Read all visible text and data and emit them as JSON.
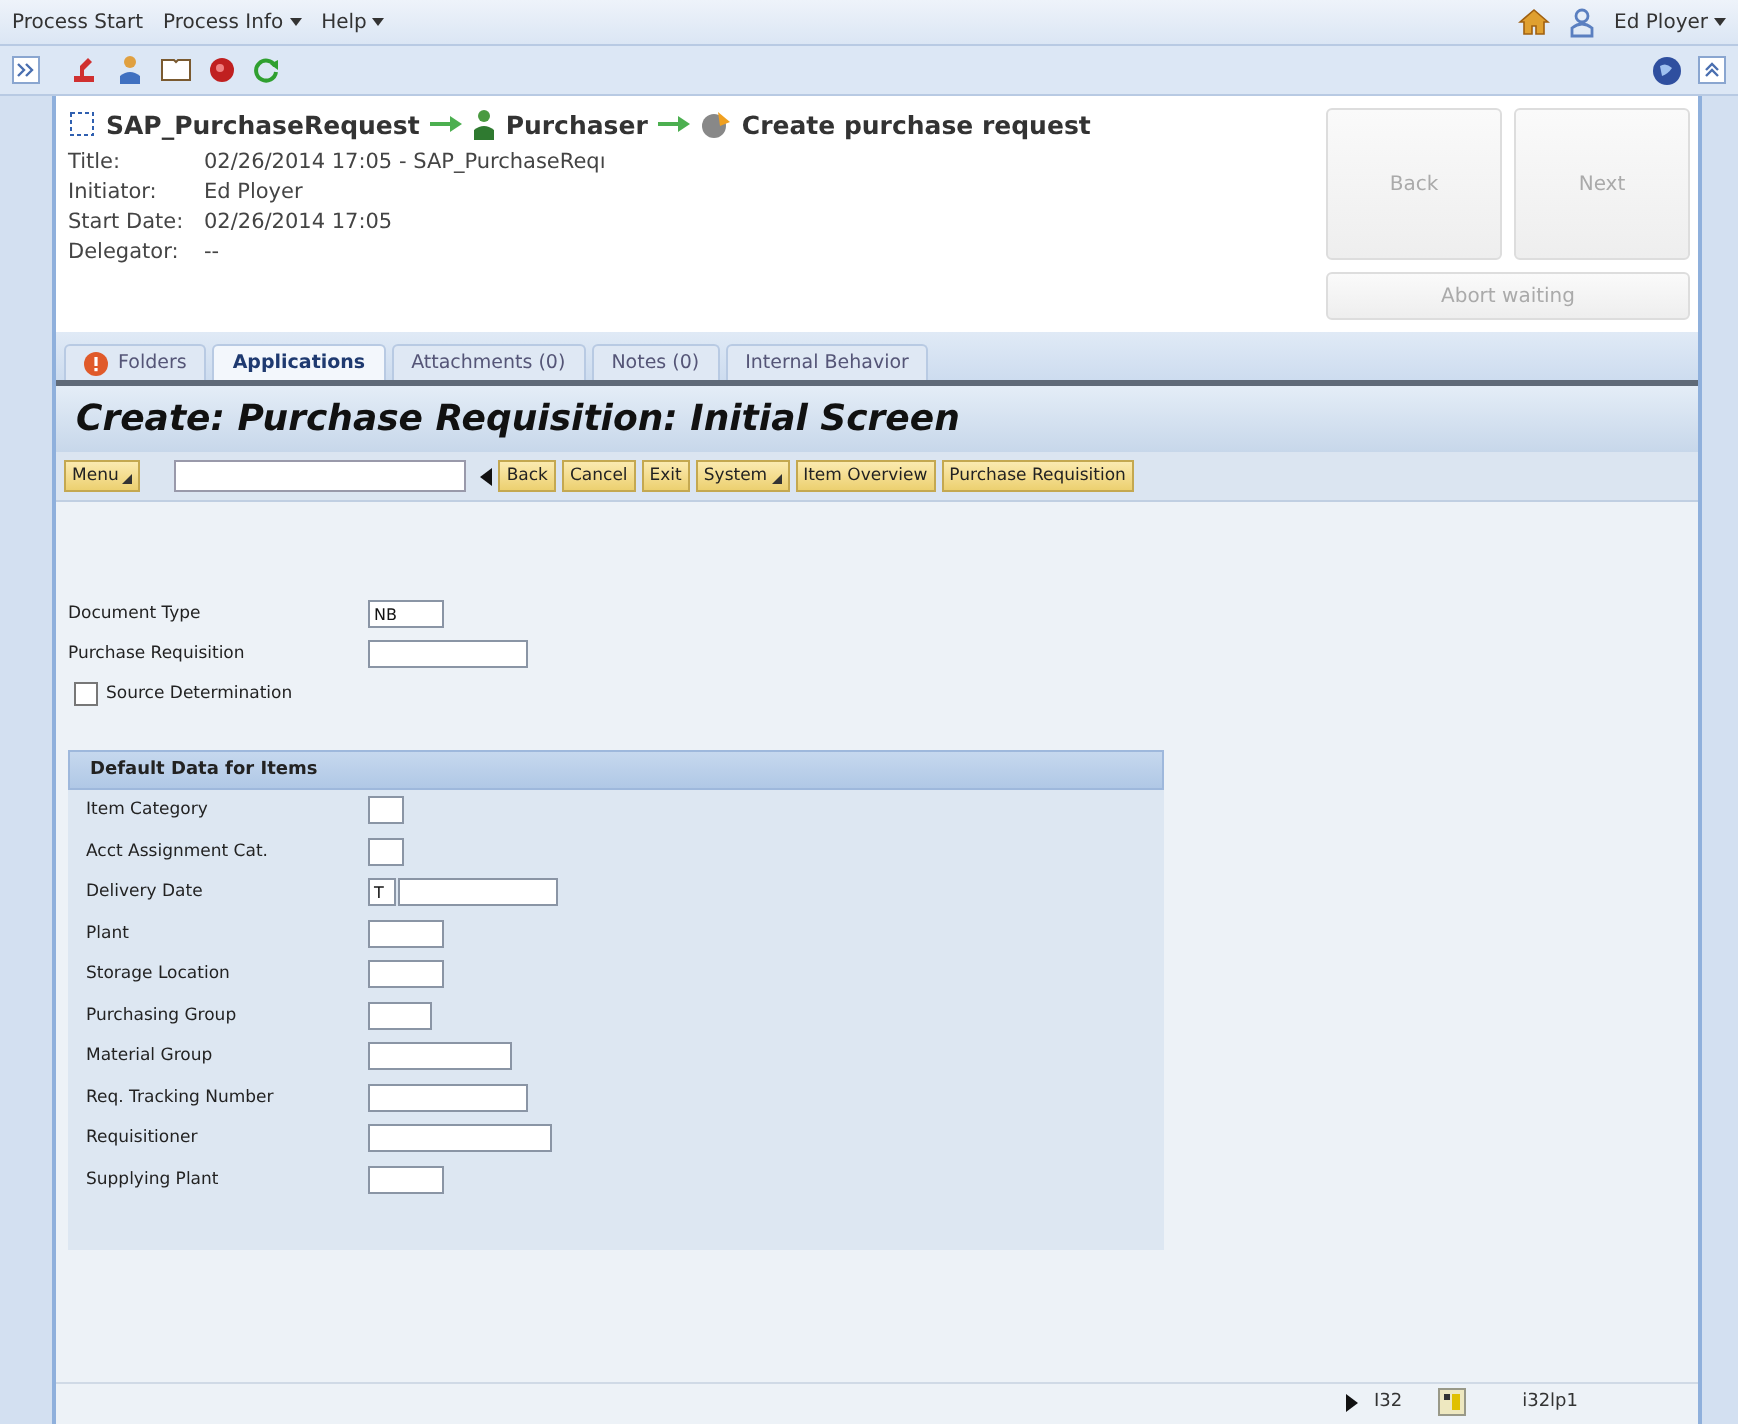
{
  "menu_bar": {
    "items": [
      {
        "label": "Process Start",
        "dropdown": false
      },
      {
        "label": "Process Info",
        "dropdown": true
      },
      {
        "label": "Help",
        "dropdown": true
      }
    ],
    "user": "Ed Ployer"
  },
  "breadcrumb": [
    {
      "kind": "process",
      "label": "SAP_PurchaseRequest"
    },
    {
      "kind": "role",
      "label": "Purchaser"
    },
    {
      "kind": "task",
      "label": "Create purchase request"
    }
  ],
  "details": [
    {
      "label": "Title:",
      "value": "02/26/2014 17:05 - SAP_PurchaseReqı"
    },
    {
      "label": "Initiator:",
      "value": "Ed Ployer"
    },
    {
      "label": "Start Date:",
      "value": "02/26/2014 17:05"
    },
    {
      "label": "Delegator:",
      "value": "--"
    }
  ],
  "nav_buttons": [
    {
      "label": "Back",
      "disabled": true
    },
    {
      "label": "Next",
      "disabled": true
    }
  ],
  "abort_button": {
    "label": "Abort waiting",
    "disabled": true
  },
  "tabs": [
    {
      "label": "Folders",
      "selected": false,
      "alert": true
    },
    {
      "label": "Applications",
      "selected": true,
      "alert": false
    },
    {
      "label": "Attachments (0)",
      "selected": false,
      "alert": false
    },
    {
      "label": "Notes (0)",
      "selected": false,
      "alert": false
    },
    {
      "label": "Internal Behavior",
      "selected": false,
      "alert": false
    }
  ],
  "sap_screen": {
    "title": "Create: Purchase Requisition: Initial Screen",
    "toolbar": [
      {
        "label": "Menu",
        "dropdown": true,
        "kind": "button"
      },
      {
        "kind": "command_field"
      },
      {
        "label": "Back",
        "dropdown": false,
        "kind": "button"
      },
      {
        "label": "Cancel",
        "dropdown": false,
        "kind": "button"
      },
      {
        "label": "Exit",
        "dropdown": false,
        "kind": "button"
      },
      {
        "label": "System",
        "dropdown": true,
        "kind": "button"
      },
      {
        "label": "Item Overview",
        "dropdown": false,
        "kind": "button"
      },
      {
        "label": "Purchase Requisition",
        "dropdown": false,
        "kind": "button"
      }
    ],
    "fields": [
      {
        "kind": "field",
        "label": "Document Type",
        "value": "NB"
      },
      {
        "kind": "field",
        "label": "Purchase Requisition"
      },
      {
        "kind": "checkbox",
        "label": "Source Determination",
        "checked": false
      }
    ],
    "group": {
      "title": "Default Data for Items",
      "fields": [
        {
          "kind": "field",
          "label": "Item Category"
        },
        {
          "kind": "field",
          "label": "Acct Assignment Cat."
        },
        {
          "kind": "date",
          "label": "Delivery Date",
          "prefix": "T"
        },
        {
          "kind": "field",
          "label": "Plant"
        },
        {
          "kind": "field",
          "label": "Storage Location"
        },
        {
          "kind": "field",
          "label": "Purchasing Group"
        },
        {
          "kind": "field",
          "label": "Material Group"
        },
        {
          "kind": "field",
          "label": "Req. Tracking Number"
        },
        {
          "kind": "field",
          "label": "Requisitioner"
        },
        {
          "kind": "field",
          "label": "Supplying Plant"
        }
      ]
    }
  },
  "status_bar": {
    "system": "I32",
    "server": "i32lp1"
  }
}
